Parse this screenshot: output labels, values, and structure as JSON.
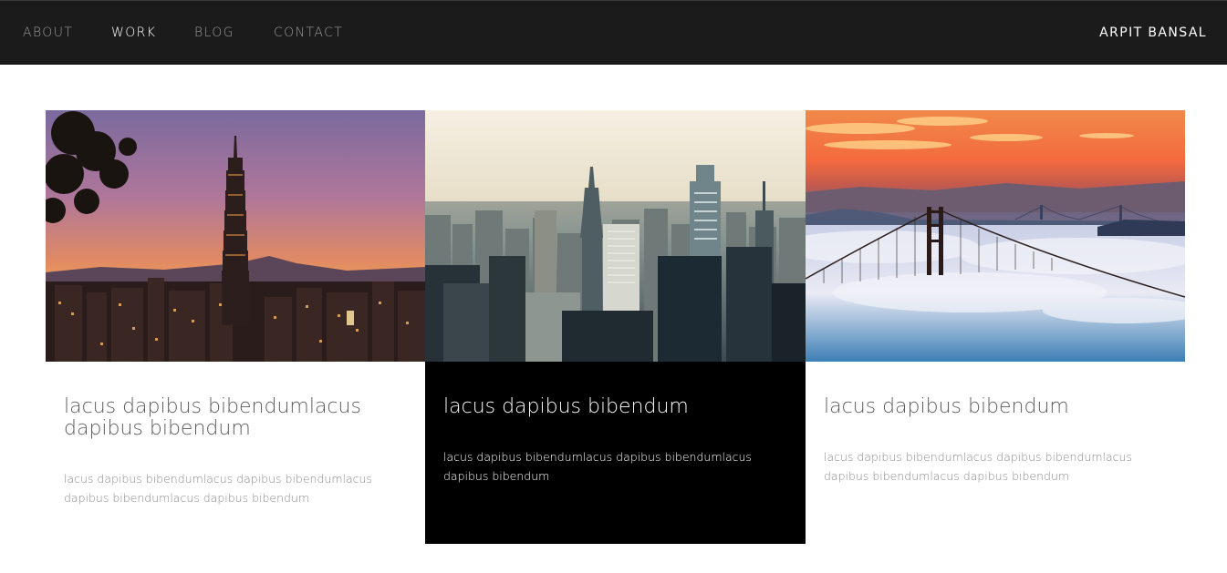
{
  "nav": {
    "links": [
      {
        "label": "ABOUT",
        "active": false
      },
      {
        "label": "WORK",
        "active": true
      },
      {
        "label": "BLOG",
        "active": false
      },
      {
        "label": "CONTACT",
        "active": false
      }
    ],
    "brand": "ARPIT BANSAL"
  },
  "cards": [
    {
      "title": "lacus dapibus bibendumlacus dapibus bibendum",
      "text": "lacus dapibus bibendumlacus dapibus bibendumlacus dapibus bibendumlacus dapibus bibendum",
      "image": "taipei-101-skyline-sunset",
      "highlighted": false
    },
    {
      "title": "lacus dapibus bibendum",
      "text": "lacus dapibus bibendumlacus dapibus bibendumlacus dapibus bibendum",
      "image": "new-york-city-aerial-skyline",
      "highlighted": true
    },
    {
      "title": "lacus dapibus bibendum",
      "text": "lacus dapibus bibendumlacus dapibus bibendumlacus dapibus bibendumlacus dapibus bibendum",
      "image": "golden-gate-bridge-fog-sunset",
      "highlighted": false
    }
  ],
  "colors": {
    "navbar_bg": "#1b1b1b",
    "nav_inactive": "#9a9a9a",
    "nav_active": "#ffffff",
    "highlight_card_bg": "#000000",
    "title_text": "#5b5b5b",
    "body_text": "#8a8a8a"
  }
}
